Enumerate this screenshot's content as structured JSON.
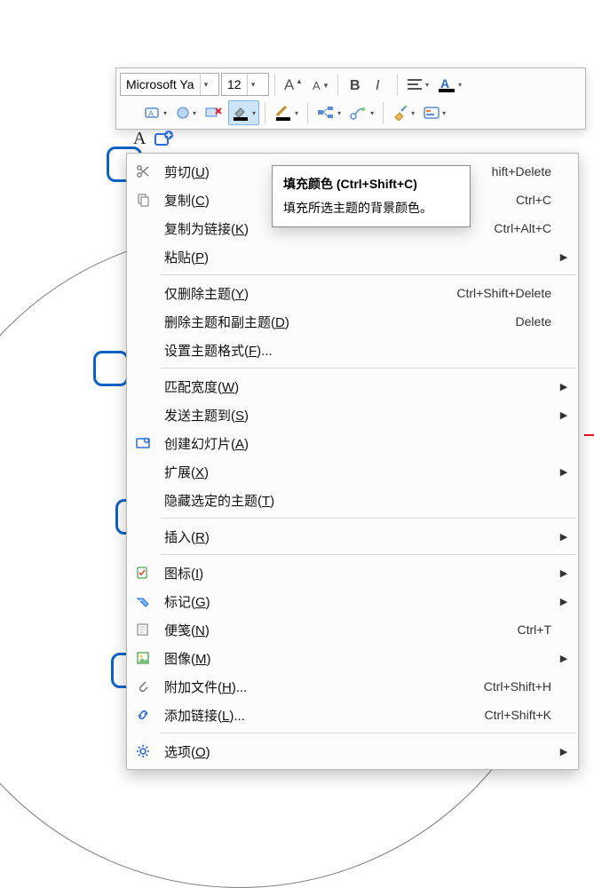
{
  "toolbar": {
    "font_name": "Microsoft Ya",
    "font_size": "12",
    "buttons": {
      "grow_font": "A▲",
      "shrink_font": "A▼",
      "bold": "B",
      "italic": "I"
    }
  },
  "tooltip": {
    "title": "填充颜色 (Ctrl+Shift+C)",
    "body": "填充所选主题的背景颜色。"
  },
  "menu": [
    {
      "icon": "scissors-icon",
      "label": "剪切",
      "accel": "U",
      "shortcut": "hift+Delete"
    },
    {
      "icon": "copy-icon",
      "label": "复制",
      "accel": "C",
      "shortcut": "Ctrl+C"
    },
    {
      "icon": "",
      "label": "复制为链接",
      "accel": "K",
      "shortcut": "Ctrl+Alt+C"
    },
    {
      "icon": "",
      "label": "粘贴",
      "accel": "P",
      "submenu": true
    },
    {
      "divider": true
    },
    {
      "icon": "",
      "label": "仅删除主题",
      "accel": "Y",
      "shortcut": "Ctrl+Shift+Delete"
    },
    {
      "icon": "",
      "label": "删除主题和副主题",
      "accel": "D",
      "shortcut": "Delete"
    },
    {
      "icon": "",
      "label": "设置主题格式",
      "accel": "F",
      "ellipsis": true
    },
    {
      "divider": true
    },
    {
      "icon": "",
      "label": "匹配宽度",
      "accel": "W",
      "submenu": true
    },
    {
      "icon": "",
      "label": "发送主题到",
      "accel": "S",
      "submenu": true
    },
    {
      "icon": "slide-icon",
      "label": "创建幻灯片",
      "accel": "A"
    },
    {
      "icon": "",
      "label": "扩展",
      "accel": "X",
      "submenu": true
    },
    {
      "icon": "",
      "label": "隐藏选定的主题",
      "accel": "T"
    },
    {
      "divider": true
    },
    {
      "icon": "",
      "label": "插入",
      "accel": "R",
      "submenu": true
    },
    {
      "divider": true
    },
    {
      "icon": "badge-icon",
      "label": "图标",
      "accel": "I",
      "submenu": true
    },
    {
      "icon": "tag-icon",
      "label": "标记",
      "accel": "G",
      "submenu": true
    },
    {
      "icon": "note-icon",
      "label": "便笺",
      "accel": "N",
      "shortcut": "Ctrl+T"
    },
    {
      "icon": "image-icon",
      "label": "图像",
      "accel": "M",
      "submenu": true
    },
    {
      "icon": "clip-icon",
      "label": "附加文件",
      "accel": "H",
      "ellipsis": true,
      "shortcut": "Ctrl+Shift+H"
    },
    {
      "icon": "link-icon",
      "label": "添加链接",
      "accel": "L",
      "ellipsis": true,
      "shortcut": "Ctrl+Shift+K"
    },
    {
      "divider": true
    },
    {
      "icon": "gear-icon",
      "label": "选项",
      "accel": "O",
      "submenu": true
    }
  ]
}
